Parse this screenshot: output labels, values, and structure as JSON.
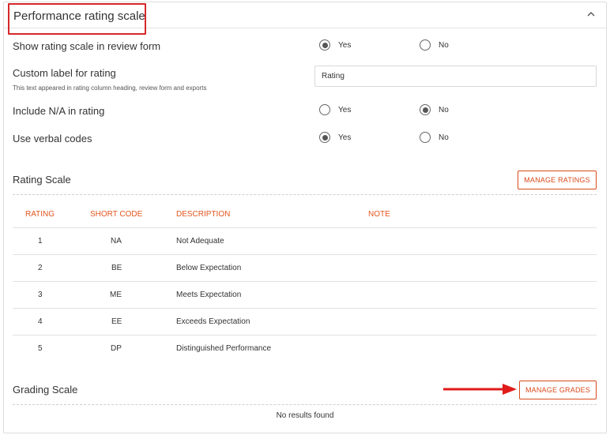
{
  "header": {
    "title": "Performance rating scale",
    "collapse_icon": "chevron-up-icon"
  },
  "settings": {
    "show_rating_scale": {
      "label": "Show rating scale in review form",
      "yes": "Yes",
      "no": "No",
      "selected": "Yes"
    },
    "custom_label": {
      "label": "Custom label for rating",
      "help": "This text appeared in rating column heading, review form and exports",
      "value": "Rating"
    },
    "include_na": {
      "label": "Include N/A in rating",
      "yes": "Yes",
      "no": "No",
      "selected": "No"
    },
    "verbal_codes": {
      "label": "Use verbal codes",
      "yes": "Yes",
      "no": "No",
      "selected": "Yes"
    }
  },
  "rating_scale": {
    "title": "Rating Scale",
    "manage_button": "MANAGE RATINGS",
    "columns": [
      "RATING",
      "SHORT CODE",
      "DESCRIPTION",
      "NOTE"
    ],
    "rows": [
      {
        "rating": "1",
        "code": "NA",
        "description": "Not Adequate",
        "note": ""
      },
      {
        "rating": "2",
        "code": "BE",
        "description": "Below Expectation",
        "note": ""
      },
      {
        "rating": "3",
        "code": "ME",
        "description": "Meets Expectation",
        "note": ""
      },
      {
        "rating": "4",
        "code": "EE",
        "description": "Exceeds Expectation",
        "note": ""
      },
      {
        "rating": "5",
        "code": "DP",
        "description": "Distinguished Performance",
        "note": ""
      }
    ]
  },
  "grading_scale": {
    "title": "Grading Scale",
    "manage_button": "MANAGE GRADES",
    "empty_text": "No results found"
  },
  "colors": {
    "accent": "#d84a1b",
    "highlight": "#d62828"
  }
}
